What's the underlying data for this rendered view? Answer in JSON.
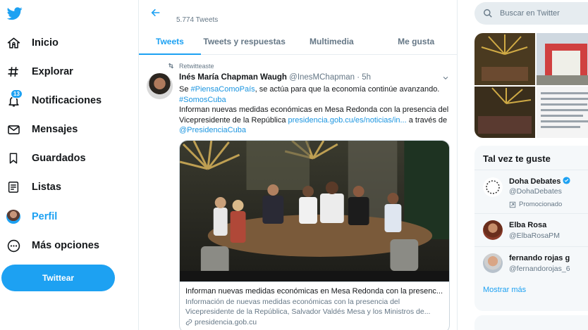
{
  "colors": {
    "accent": "#1da1f2",
    "text": "#14171a",
    "muted": "#657786",
    "link": "#1b95e0"
  },
  "nav": {
    "items": [
      {
        "label": "Inicio",
        "icon": "home-icon"
      },
      {
        "label": "Explorar",
        "icon": "hashtag-icon"
      },
      {
        "label": "Notificaciones",
        "icon": "bell-icon",
        "badge": "13"
      },
      {
        "label": "Mensajes",
        "icon": "envelope-icon"
      },
      {
        "label": "Guardados",
        "icon": "bookmark-icon"
      },
      {
        "label": "Listas",
        "icon": "list-icon"
      },
      {
        "label": "Perfil",
        "icon": "avatar"
      },
      {
        "label": "Más opciones",
        "icon": "more-icon"
      }
    ],
    "tweet_button": "Twittear"
  },
  "profile_header": {
    "tweet_count": "5.774 Tweets"
  },
  "tabs": [
    "Tweets",
    "Tweets y respuestas",
    "Multimedia",
    "Me gusta"
  ],
  "tweet": {
    "retweet_label": "Retwitteaste",
    "author_name": "Inés María Chapman Waugh",
    "author_handle": "@InesMChapman",
    "time": "5h",
    "text_line1_a": "Se ",
    "hashtag1": "#PiensaComoPaís",
    "text_line1_b": ", se actúa para que la economía continúe avanzando.",
    "hashtag2": "#SomosCuba",
    "text_body": "Informan nuevas medidas económicas en Mesa Redonda con la presencia del Vicepresidente de la República ",
    "link": "presidencia.gob.cu/es/noticias/in...",
    "text_after_link": " a través de ",
    "mention": "@PresidenciaCuba",
    "card": {
      "title": "Informan nuevas medidas económicas en Mesa Redonda con la presenc...",
      "description": "Información de nuevas medidas económicas con la presencia del Vicepresidente de la República, Salvador Valdés Mesa y los Ministros de...",
      "domain": "presidencia.gob.cu"
    }
  },
  "search": {
    "placeholder": "Buscar en Twitter"
  },
  "suggestions": {
    "title": "Tal vez te guste",
    "users": [
      {
        "name": "Doha Debates",
        "handle": "@DohaDebates",
        "verified": true,
        "promoted": "Promocionado"
      },
      {
        "name": "Elba Rosa",
        "handle": "@ElbaRosaPM"
      },
      {
        "name": "fernando rojas g",
        "handle": "@fernandorojas_6"
      }
    ],
    "show_more": "Mostrar más"
  }
}
